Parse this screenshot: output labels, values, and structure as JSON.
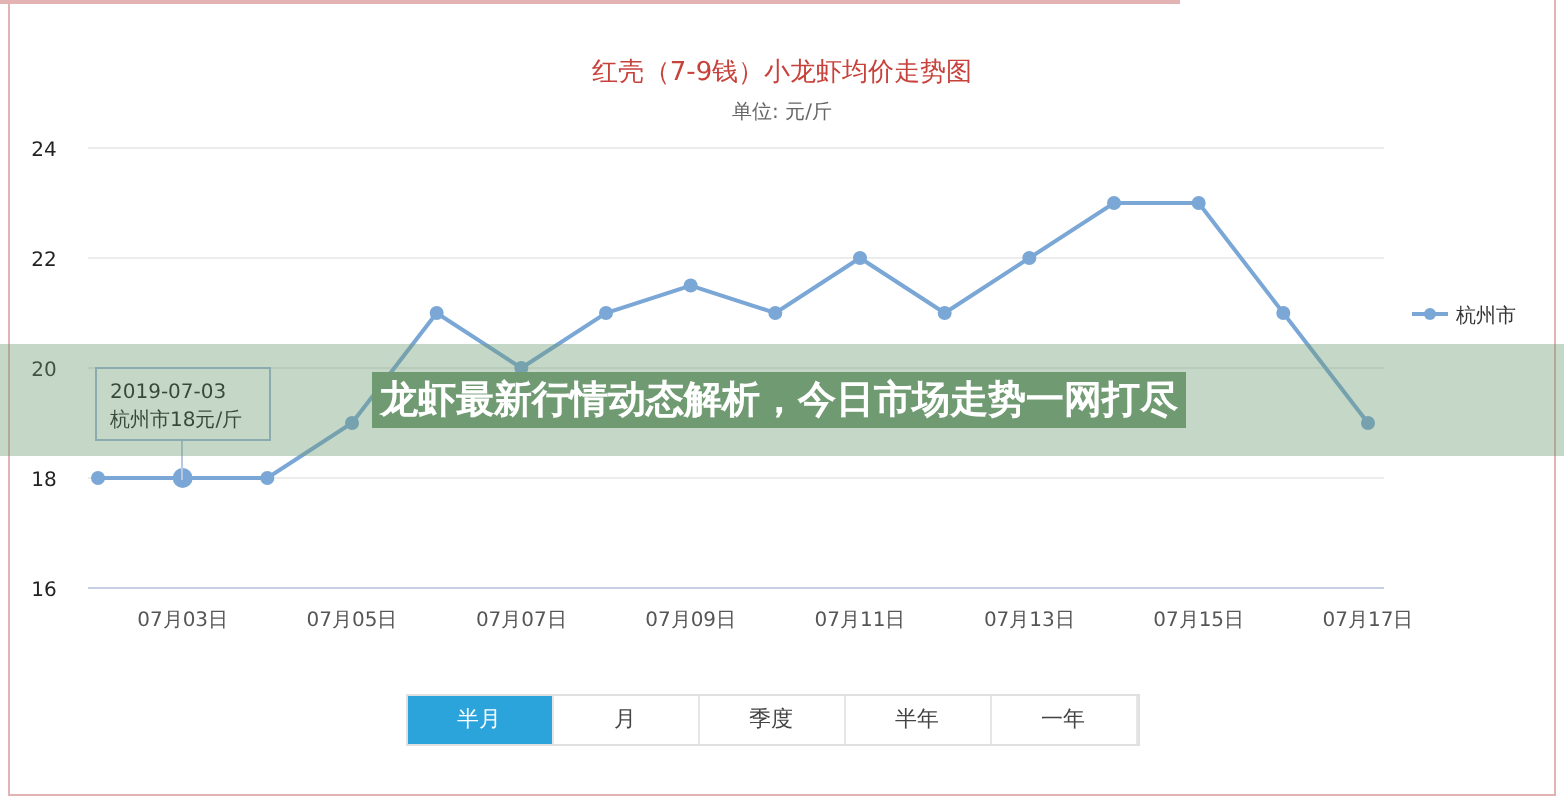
{
  "banner": {
    "headline": "龙虾最新行情动态解析，今日市场走势一网打尽"
  },
  "chart": {
    "subtitle": "单位: 元/斤",
    "tooltip": {
      "date": "2019-07-03",
      "text": "杭州市18元/斤"
    },
    "chart_data": {
      "type": "line",
      "title": "红壳（7-9钱）小龙虾均价走势图",
      "categories": [
        null,
        "07月03日",
        null,
        "07月05日",
        null,
        "07月07日",
        null,
        "07月09日",
        null,
        "07月11日",
        null,
        "07月13日",
        null,
        "07月15日",
        null,
        "07月17日"
      ],
      "series": [
        {
          "name": "杭州市",
          "color": "#7aa7d6",
          "marker": true,
          "values": [
            18,
            18,
            18,
            19,
            21,
            20,
            21,
            21.5,
            21,
            22,
            21,
            22,
            23,
            23,
            21,
            19
          ]
        }
      ],
      "grid": true,
      "ylim": [
        16,
        24
      ],
      "yticks": [
        16,
        18,
        20,
        22,
        24
      ]
    }
  },
  "range_buttons": [
    {
      "label": "半月",
      "selected": true
    },
    {
      "label": "月",
      "selected": false
    },
    {
      "label": "季度",
      "selected": false
    },
    {
      "label": "半年",
      "selected": false
    },
    {
      "label": "一年",
      "selected": false
    }
  ]
}
